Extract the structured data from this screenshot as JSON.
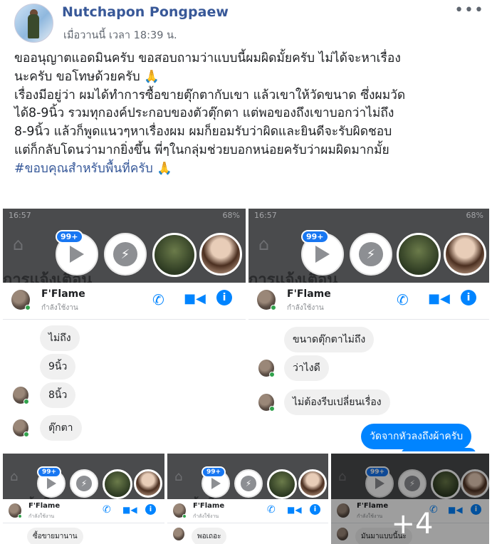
{
  "post": {
    "author": "Nutchapon Pongpaew",
    "timestamp": "เมื่อวานนี้ เวลา 18:39 น.",
    "more_label": "•••",
    "body_lines": [
      "ขออนุญาตแอดมินครับ ขอสอบถามว่าแบบนี้ผมผิดมั้ยครับ ไม่ได้จะหาเรื่อง",
      "นะครับ ขอโทษด้วยครับ",
      "เรื่องมีอยู่ว่า ผมได้ทำการซื้อขายตุ๊กตากับเขา แล้วเขาให้วัดขนาด ซึ่งผมวัด",
      "ได้8-9นิ้ว รวมทุกองค์ประกอบของตัวตุ๊กตา แต่พอของถึงเขาบอกว่าไม่ถึง",
      "8-9นิ้ว แล้วก็พูดแนวๆหาเรื่องผม ผมก็ยอมรับว่าผิดและยินดีจะรับผิดชอบ",
      "แต่ก็กลับโดนว่ามากยิ่งขึ้น พี่ๆในกลุ่มช่วยบอกหน่อยครับว่าผมผิดมากมั้ย"
    ],
    "hashtag": "#ขอบคุณสำหรับพื้นที่ครับ",
    "emoji": "🙏"
  },
  "screens": {
    "status_time": "16:57",
    "battery": "68%",
    "badge": "99+",
    "chat_name": "F'Flame",
    "chat_status": "กำลังใช้งาน",
    "header_title": "การแจ้งเตือน",
    "shot1": {
      "messages": [
        "ไม่ถึง",
        "9นิ้ว",
        "8นิ้ว",
        "ตุ๊กตา"
      ]
    },
    "shot2": {
      "messages": [
        "ขนาดตุ๊กตาไม่ถึง",
        "ว่าไงดี",
        "ไม่ต้องรีบเปลี่ยนเรื่อง"
      ],
      "outgoing": [
        "วัดจากหัวลงถึงผ้าครับ"
      ]
    },
    "shot3": {
      "messages": [
        "ซื้อขายมานาน"
      ]
    },
    "shot4": {
      "messages": [
        "พอเถอะ"
      ]
    },
    "shot5": {
      "messages": [
        "มันมาแบบนี้นะ"
      ]
    },
    "more_count": "+4"
  }
}
